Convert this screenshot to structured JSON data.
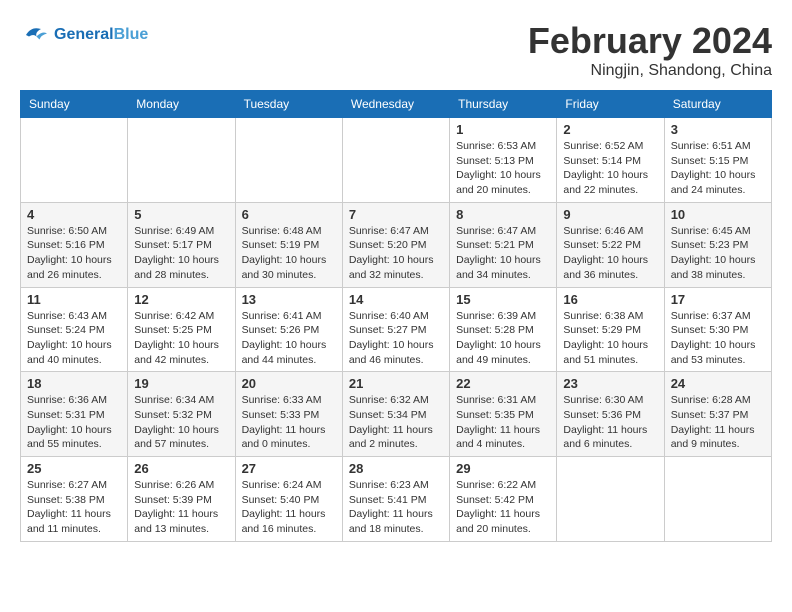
{
  "header": {
    "logo_line1": "General",
    "logo_line2": "Blue",
    "month": "February 2024",
    "location": "Ningjin, Shandong, China"
  },
  "days_of_week": [
    "Sunday",
    "Monday",
    "Tuesday",
    "Wednesday",
    "Thursday",
    "Friday",
    "Saturday"
  ],
  "weeks": [
    [
      {
        "day": "",
        "info": ""
      },
      {
        "day": "",
        "info": ""
      },
      {
        "day": "",
        "info": ""
      },
      {
        "day": "",
        "info": ""
      },
      {
        "day": "1",
        "info": "Sunrise: 6:53 AM\nSunset: 5:13 PM\nDaylight: 10 hours\nand 20 minutes."
      },
      {
        "day": "2",
        "info": "Sunrise: 6:52 AM\nSunset: 5:14 PM\nDaylight: 10 hours\nand 22 minutes."
      },
      {
        "day": "3",
        "info": "Sunrise: 6:51 AM\nSunset: 5:15 PM\nDaylight: 10 hours\nand 24 minutes."
      }
    ],
    [
      {
        "day": "4",
        "info": "Sunrise: 6:50 AM\nSunset: 5:16 PM\nDaylight: 10 hours\nand 26 minutes."
      },
      {
        "day": "5",
        "info": "Sunrise: 6:49 AM\nSunset: 5:17 PM\nDaylight: 10 hours\nand 28 minutes."
      },
      {
        "day": "6",
        "info": "Sunrise: 6:48 AM\nSunset: 5:19 PM\nDaylight: 10 hours\nand 30 minutes."
      },
      {
        "day": "7",
        "info": "Sunrise: 6:47 AM\nSunset: 5:20 PM\nDaylight: 10 hours\nand 32 minutes."
      },
      {
        "day": "8",
        "info": "Sunrise: 6:47 AM\nSunset: 5:21 PM\nDaylight: 10 hours\nand 34 minutes."
      },
      {
        "day": "9",
        "info": "Sunrise: 6:46 AM\nSunset: 5:22 PM\nDaylight: 10 hours\nand 36 minutes."
      },
      {
        "day": "10",
        "info": "Sunrise: 6:45 AM\nSunset: 5:23 PM\nDaylight: 10 hours\nand 38 minutes."
      }
    ],
    [
      {
        "day": "11",
        "info": "Sunrise: 6:43 AM\nSunset: 5:24 PM\nDaylight: 10 hours\nand 40 minutes."
      },
      {
        "day": "12",
        "info": "Sunrise: 6:42 AM\nSunset: 5:25 PM\nDaylight: 10 hours\nand 42 minutes."
      },
      {
        "day": "13",
        "info": "Sunrise: 6:41 AM\nSunset: 5:26 PM\nDaylight: 10 hours\nand 44 minutes."
      },
      {
        "day": "14",
        "info": "Sunrise: 6:40 AM\nSunset: 5:27 PM\nDaylight: 10 hours\nand 46 minutes."
      },
      {
        "day": "15",
        "info": "Sunrise: 6:39 AM\nSunset: 5:28 PM\nDaylight: 10 hours\nand 49 minutes."
      },
      {
        "day": "16",
        "info": "Sunrise: 6:38 AM\nSunset: 5:29 PM\nDaylight: 10 hours\nand 51 minutes."
      },
      {
        "day": "17",
        "info": "Sunrise: 6:37 AM\nSunset: 5:30 PM\nDaylight: 10 hours\nand 53 minutes."
      }
    ],
    [
      {
        "day": "18",
        "info": "Sunrise: 6:36 AM\nSunset: 5:31 PM\nDaylight: 10 hours\nand 55 minutes."
      },
      {
        "day": "19",
        "info": "Sunrise: 6:34 AM\nSunset: 5:32 PM\nDaylight: 10 hours\nand 57 minutes."
      },
      {
        "day": "20",
        "info": "Sunrise: 6:33 AM\nSunset: 5:33 PM\nDaylight: 11 hours\nand 0 minutes."
      },
      {
        "day": "21",
        "info": "Sunrise: 6:32 AM\nSunset: 5:34 PM\nDaylight: 11 hours\nand 2 minutes."
      },
      {
        "day": "22",
        "info": "Sunrise: 6:31 AM\nSunset: 5:35 PM\nDaylight: 11 hours\nand 4 minutes."
      },
      {
        "day": "23",
        "info": "Sunrise: 6:30 AM\nSunset: 5:36 PM\nDaylight: 11 hours\nand 6 minutes."
      },
      {
        "day": "24",
        "info": "Sunrise: 6:28 AM\nSunset: 5:37 PM\nDaylight: 11 hours\nand 9 minutes."
      }
    ],
    [
      {
        "day": "25",
        "info": "Sunrise: 6:27 AM\nSunset: 5:38 PM\nDaylight: 11 hours\nand 11 minutes."
      },
      {
        "day": "26",
        "info": "Sunrise: 6:26 AM\nSunset: 5:39 PM\nDaylight: 11 hours\nand 13 minutes."
      },
      {
        "day": "27",
        "info": "Sunrise: 6:24 AM\nSunset: 5:40 PM\nDaylight: 11 hours\nand 16 minutes."
      },
      {
        "day": "28",
        "info": "Sunrise: 6:23 AM\nSunset: 5:41 PM\nDaylight: 11 hours\nand 18 minutes."
      },
      {
        "day": "29",
        "info": "Sunrise: 6:22 AM\nSunset: 5:42 PM\nDaylight: 11 hours\nand 20 minutes."
      },
      {
        "day": "",
        "info": ""
      },
      {
        "day": "",
        "info": ""
      }
    ]
  ]
}
